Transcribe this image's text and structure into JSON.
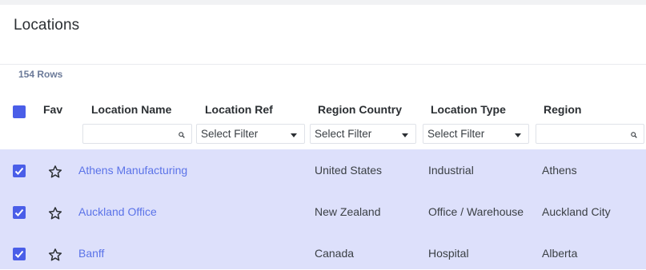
{
  "page": {
    "title": "Locations",
    "row_count": "154 Rows"
  },
  "columns": {
    "fav": "Fav",
    "location_name": "Location Name",
    "location_ref": "Location Ref",
    "region_country": "Region Country",
    "location_type": "Location Type",
    "region": "Region"
  },
  "filters": {
    "location_ref": "Select Filter",
    "region_country": "Select Filter",
    "location_type": "Select Filter"
  },
  "rows": [
    {
      "name": "Athens Manufacturing",
      "ref": "",
      "country": "United States",
      "type": "Industrial",
      "region": "Athens",
      "selected": true,
      "favorite": false
    },
    {
      "name": "Auckland Office",
      "ref": "",
      "country": "New Zealand",
      "type": "Office / Warehouse",
      "region": "Auckland City",
      "selected": true,
      "favorite": false
    },
    {
      "name": "Banff",
      "ref": "",
      "country": "Canada",
      "type": "Hospital",
      "region": "Alberta",
      "selected": true,
      "favorite": false
    }
  ],
  "colors": {
    "accent": "#4a5ee8",
    "link": "#5b73e8",
    "row_selected_bg": "#dde0fb"
  },
  "icons": {
    "search": "search-icon",
    "star": "star-outline-icon",
    "checkbox": "checkbox-checked-icon",
    "dropdown": "chevron-down-icon"
  }
}
